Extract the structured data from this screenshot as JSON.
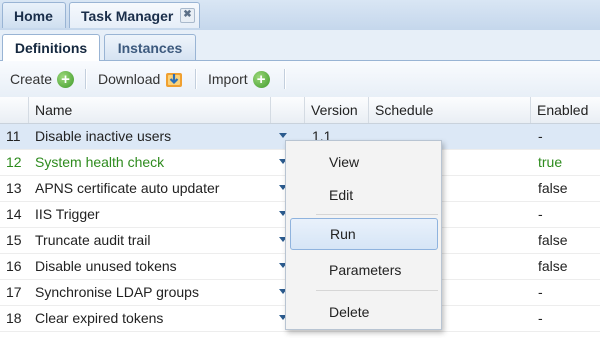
{
  "top_tabs": [
    {
      "label": "Home"
    },
    {
      "label": "Task Manager",
      "close_icon": "close-icon"
    }
  ],
  "sub_tabs": [
    {
      "label": "Definitions",
      "active": true
    },
    {
      "label": "Instances",
      "active": false
    }
  ],
  "toolbar": {
    "create_label": "Create",
    "download_label": "Download",
    "import_label": "Import"
  },
  "grid": {
    "columns": [
      "Name",
      "Version",
      "Schedule",
      "Enabled"
    ],
    "rows": [
      {
        "num": "11",
        "name": "Disable inactive users",
        "version": "1.1",
        "enabled": "-",
        "selected": true
      },
      {
        "num": "12",
        "name": "System health check",
        "version": "",
        "enabled": "true",
        "status_color": "#2e8b1e"
      },
      {
        "num": "13",
        "name": "APNS certificate auto updater",
        "version": "",
        "enabled": "false"
      },
      {
        "num": "14",
        "name": "IIS Trigger",
        "version": "",
        "enabled": "-"
      },
      {
        "num": "15",
        "name": "Truncate audit trail",
        "version": "",
        "enabled": "false"
      },
      {
        "num": "16",
        "name": "Disable unused tokens",
        "version": "",
        "enabled": "false"
      },
      {
        "num": "17",
        "name": "Synchronise LDAP groups",
        "version": "",
        "enabled": "-"
      },
      {
        "num": "18",
        "name": "Clear expired tokens",
        "version": "",
        "enabled": "-"
      }
    ]
  },
  "context_menu": {
    "items": [
      "View",
      "Edit",
      "Run",
      "Parameters",
      "Delete"
    ],
    "hovered": "Run"
  },
  "colors": {
    "accent": "#99b4d4",
    "selected_row": "#dce8f6",
    "enabled_true": "#2e8b1e",
    "icon_green": "#3f9a2a",
    "icon_orange": "#f0a030"
  }
}
